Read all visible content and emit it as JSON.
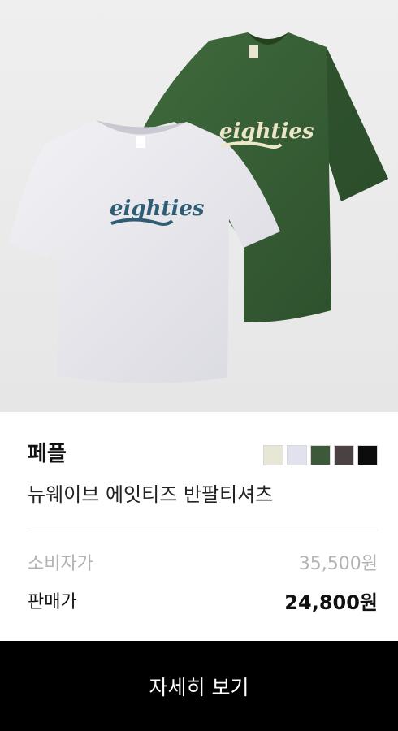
{
  "product": {
    "brand": "페플",
    "name": "뉴웨이브 에잇티즈 반팔티셔츠",
    "logo_text": "eighties",
    "colors": [
      "#e8e6d6",
      "#e2e2ee",
      "#3c5a3a",
      "#4a4242",
      "#0c0c0c"
    ]
  },
  "pricing": {
    "retail_label": "소비자가",
    "retail_value": "35,500원",
    "sale_label": "판매가",
    "sale_value": "24,800원"
  },
  "action": {
    "detail_label": "자세히 보기"
  }
}
